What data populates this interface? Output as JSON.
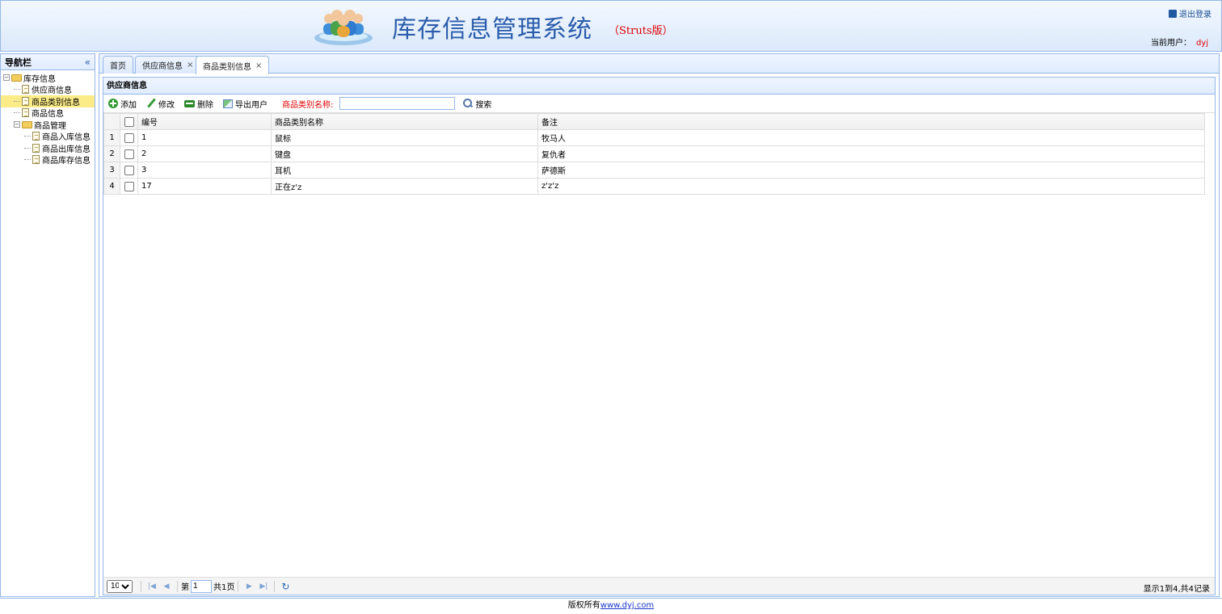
{
  "header": {
    "title": "库存信息管理系统",
    "subtitle": "（Struts版）",
    "logout_label": "退出登录",
    "current_user_label": "当前用户：",
    "current_user": "dyj"
  },
  "nav": {
    "title": "导航栏",
    "collapse_icon": "«",
    "tree": [
      {
        "label": "库存信息",
        "type": "folder"
      },
      {
        "label": "供应商信息",
        "type": "leaf"
      },
      {
        "label": "商品类别信息",
        "type": "leaf",
        "selected": true
      },
      {
        "label": "商品信息",
        "type": "leaf"
      },
      {
        "label": "商品管理",
        "type": "folder"
      },
      {
        "label": "商品入库信息",
        "type": "leaf"
      },
      {
        "label": "商品出库信息",
        "type": "leaf"
      },
      {
        "label": "商品库存信息",
        "type": "leaf"
      }
    ]
  },
  "tabs": [
    {
      "label": "首页",
      "closable": false
    },
    {
      "label": "供应商信息",
      "closable": true
    },
    {
      "label": "商品类别信息",
      "closable": true,
      "active": true
    }
  ],
  "panel": {
    "title": "供应商信息",
    "toolbar": {
      "add": "添加",
      "edit": "修改",
      "delete": "删除",
      "export": "导出用户",
      "search_label": "商品类别名称:",
      "search_value": "",
      "search_button": "搜索"
    },
    "table": {
      "columns": [
        "编号",
        "商品类别名称",
        "备注"
      ],
      "rows": [
        {
          "n": "1",
          "id": "1",
          "name": "鼠标",
          "note": "牧马人"
        },
        {
          "n": "2",
          "id": "2",
          "name": "键盘",
          "note": "复仇者"
        },
        {
          "n": "3",
          "id": "3",
          "name": "耳机",
          "note": "萨德斯"
        },
        {
          "n": "4",
          "id": "17",
          "name": "正在z'z",
          "note": "z'z'z"
        }
      ]
    },
    "pager": {
      "page_size": "10",
      "page_prefix": "第",
      "page_value": "1",
      "page_suffix": "共1页",
      "info": "显示1到4,共4记录"
    }
  },
  "footer": {
    "text": "版权所有",
    "link": "www.dyj.com"
  },
  "colors": {
    "accent": "#95b8e7",
    "title_blue": "#2a5cab",
    "red": "#e00000",
    "selected": "#fbec88"
  }
}
